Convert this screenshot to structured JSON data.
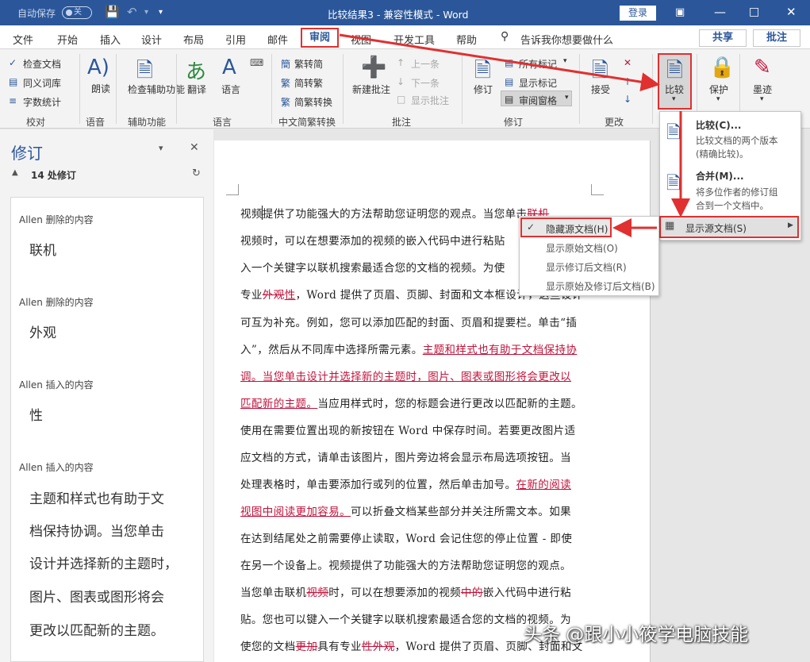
{
  "titlebar": {
    "autosave": "自动保存",
    "autosave_state": "关",
    "title": "比较结果3  -  兼容性模式  -  Word",
    "login": "登录"
  },
  "tabs": [
    "文件",
    "开始",
    "插入",
    "设计",
    "布局",
    "引用",
    "邮件",
    "审阅",
    "视图",
    "开发工具",
    "帮助"
  ],
  "tell_me": "告诉我你想要做什么",
  "share": "共享",
  "annotations_btn": "批注",
  "ribbon": {
    "proofing": {
      "items": [
        "检查文档",
        "同义词库",
        "字数统计"
      ],
      "label": "校对"
    },
    "speech": {
      "item": "朗读",
      "label": "语音"
    },
    "accessibility": {
      "item": "检查辅助功能",
      "label": "辅助功能"
    },
    "language": {
      "translate": "翻译",
      "language": "语言",
      "label": "语言"
    },
    "chinese_convert": {
      "items": [
        "繁转简",
        "简转繁",
        "简繁转换"
      ],
      "label": "中文简繁转换"
    },
    "comments": {
      "new": "新建批注",
      "prev": "上一条",
      "next": "下一条",
      "show": "显示批注",
      "label": "批注"
    },
    "tracking": {
      "track": "修订",
      "all_markup": "所有标记",
      "show_markup": "显示标记",
      "reviewing_pane": "审阅窗格",
      "label": "修订"
    },
    "changes": {
      "accept": "接受",
      "label": "更改"
    },
    "compare": {
      "label": "比较"
    },
    "protect": {
      "label": "保护"
    },
    "ink": {
      "label": "墨迹"
    }
  },
  "pane": {
    "title": "修订",
    "count": "14 处修订",
    "items": [
      {
        "head": "Allen 删除的内容",
        "body": [
          "联机"
        ]
      },
      {
        "head": "Allen 删除的内容",
        "body": [
          "外观"
        ]
      },
      {
        "head": "Allen 插入的内容",
        "body": [
          "性"
        ]
      },
      {
        "head": "Allen 插入的内容",
        "body": [
          "主题和样式也有助于文",
          "档保持协调。当您单击",
          "设计并选择新的主题时，",
          "图片、图表或图形将会",
          "更改以匹配新的主题。"
        ]
      }
    ]
  },
  "document": {
    "lines": [
      [
        [
          "n",
          "视频提供了功能强大的方法帮助您证明您的观点。当您单击"
        ],
        [
          "d",
          "联机"
        ]
      ],
      [
        [
          "n",
          "视频时，可以在想要添加的视频的嵌入代码中进行粘贴"
        ]
      ],
      [
        [
          "n",
          "入一个关键字以联机搜索最适合您的文档的视频。为使"
        ]
      ],
      [
        [
          "n",
          "专业"
        ],
        [
          "d",
          "外观"
        ],
        [
          "i",
          "性"
        ],
        [
          "n",
          "，Word 提供了页眉、页脚、封面和文本框设计，这些设计"
        ]
      ],
      [
        [
          "n",
          "可互为补充。例如，您可以添加匹配的封面、页眉和提要栏。单击“插"
        ]
      ],
      [
        [
          "n",
          "入”，然后从不同库中选择所需元素。"
        ],
        [
          "i",
          "主题和样式也有助于文档保持协"
        ]
      ],
      [
        [
          "i",
          "调。当您单击设计并选择新的主题时，图片、图表或图形将会更改以"
        ]
      ],
      [
        [
          "i",
          "匹配新的主题。"
        ],
        [
          "n",
          "当应用样式时，您的标题会进行更改以匹配新的主题。"
        ]
      ],
      [
        [
          "n",
          "使用在需要位置出现的新按钮在 Word 中保存时间。若要更改图片适"
        ]
      ],
      [
        [
          "n",
          "应文档的方式，请单击该图片，图片旁边将会显示布局选项按钮。当"
        ]
      ],
      [
        [
          "n",
          "处理表格时，单击要添加行或列的位置，然后单击加号。"
        ],
        [
          "i",
          "在新的阅读"
        ]
      ],
      [
        [
          "i",
          "视图中阅读更加容易。"
        ],
        [
          "n",
          "可以折叠文档某些部分并关注所需文本。如果"
        ]
      ],
      [
        [
          "n",
          "在达到结尾处之前需要停止读取，Word 会记住您的停止位置 - 即使"
        ]
      ],
      [
        [
          "n",
          "在另一个设备上。视频提供了功能强大的方法帮助您证明您的观点。"
        ]
      ],
      [
        [
          "n",
          "当您单击联机"
        ],
        [
          "d",
          "视频"
        ],
        [
          "n",
          "时，可以在想要添加的视频"
        ],
        [
          "d",
          "中的"
        ],
        [
          "n",
          "嵌入代码中进行粘"
        ]
      ],
      [
        [
          "n",
          "贴。您也可以键入一个关键字以联机搜索最适合您的文档的视频。为"
        ]
      ],
      [
        [
          "n",
          "使您的文档"
        ],
        [
          "d",
          "更加"
        ],
        [
          "n",
          "具有专业"
        ],
        [
          "d",
          "性外观"
        ],
        [
          "n",
          "，Word 提供了页眉、页脚、封面和文"
        ]
      ]
    ]
  },
  "compare_menu": {
    "compare_title": "比较(C)...",
    "compare_desc1": "比较文档的两个版本",
    "compare_desc2": "(精确比较)。",
    "combine_title": "合并(M)...",
    "combine_desc1": "将多位作者的修订组",
    "combine_desc2": "合到一个文档中。",
    "show_source": "显示源文档(S)"
  },
  "submenu": [
    "隐藏源文档(H)",
    "显示原始文档(O)",
    "显示修订后文档(R)",
    "显示原始及修订后文档(B)"
  ],
  "watermark": "头条 @跟小小筱学电脑技能",
  "colors": {
    "word_blue": "#2b579a",
    "highlight_red": "#e03030",
    "revision": "#c0143c"
  }
}
